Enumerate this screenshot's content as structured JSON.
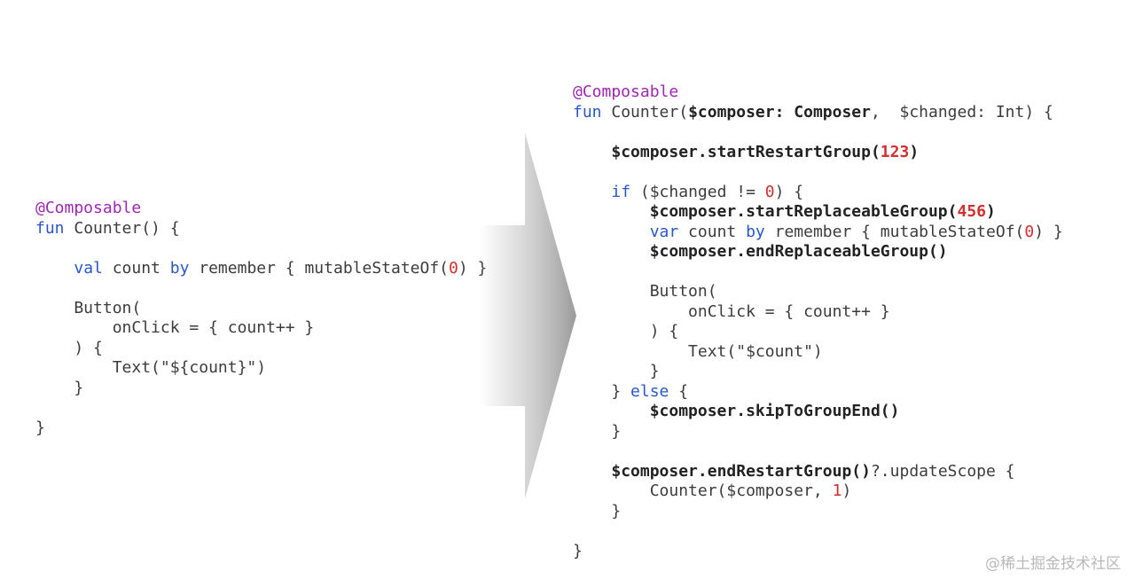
{
  "before_code": {
    "lines": [
      [
        {
          "t": "@Composable",
          "s": "annotation"
        }
      ],
      [
        {
          "t": "fun",
          "s": "keyword"
        },
        {
          "t": " Counter() {",
          "s": "plain"
        }
      ],
      [],
      [
        {
          "t": "    ",
          "s": "plain"
        },
        {
          "t": "val",
          "s": "keyword"
        },
        {
          "t": " count ",
          "s": "plain"
        },
        {
          "t": "by",
          "s": "keyword"
        },
        {
          "t": " remember { mutableStateOf(",
          "s": "plain"
        },
        {
          "t": "0",
          "s": "number"
        },
        {
          "t": ") }",
          "s": "plain"
        }
      ],
      [],
      [
        {
          "t": "    Button(",
          "s": "plain"
        }
      ],
      [
        {
          "t": "        onClick = { count++ }",
          "s": "plain"
        }
      ],
      [
        {
          "t": "    ) {",
          "s": "plain"
        }
      ],
      [
        {
          "t": "        Text(\"${count}\")",
          "s": "plain"
        }
      ],
      [
        {
          "t": "    }",
          "s": "plain"
        }
      ],
      [],
      [
        {
          "t": "}",
          "s": "plain"
        }
      ]
    ]
  },
  "after_code": {
    "lines": [
      [
        {
          "t": "@Composable",
          "s": "annotation"
        }
      ],
      [
        {
          "t": "fun",
          "s": "keyword"
        },
        {
          "t": " Counter(",
          "s": "plain"
        },
        {
          "t": "$composer: Composer",
          "s": "bold"
        },
        {
          "t": ",  $changed: Int) {",
          "s": "plain"
        }
      ],
      [],
      [
        {
          "t": "    ",
          "s": "plain"
        },
        {
          "t": "$composer.startRestartGroup(",
          "s": "bold"
        },
        {
          "t": "123",
          "s": "bold-number"
        },
        {
          "t": ")",
          "s": "bold"
        }
      ],
      [],
      [
        {
          "t": "    ",
          "s": "plain"
        },
        {
          "t": "if",
          "s": "keyword"
        },
        {
          "t": " ($changed != ",
          "s": "plain"
        },
        {
          "t": "0",
          "s": "number"
        },
        {
          "t": ") {",
          "s": "plain"
        }
      ],
      [
        {
          "t": "        ",
          "s": "plain"
        },
        {
          "t": "$composer.startReplaceableGroup(",
          "s": "bold"
        },
        {
          "t": "456",
          "s": "bold-number"
        },
        {
          "t": ")",
          "s": "bold"
        }
      ],
      [
        {
          "t": "        ",
          "s": "plain"
        },
        {
          "t": "var",
          "s": "keyword"
        },
        {
          "t": " count ",
          "s": "plain"
        },
        {
          "t": "by",
          "s": "keyword"
        },
        {
          "t": " remember { mutableStateOf(",
          "s": "plain"
        },
        {
          "t": "0",
          "s": "number"
        },
        {
          "t": ") }",
          "s": "plain"
        }
      ],
      [
        {
          "t": "        ",
          "s": "plain"
        },
        {
          "t": "$composer.endReplaceableGroup()",
          "s": "bold"
        }
      ],
      [],
      [
        {
          "t": "        Button(",
          "s": "plain"
        }
      ],
      [
        {
          "t": "            onClick = { count++ }",
          "s": "plain"
        }
      ],
      [
        {
          "t": "        ) {",
          "s": "plain"
        }
      ],
      [
        {
          "t": "            Text(\"$count\")",
          "s": "plain"
        }
      ],
      [
        {
          "t": "        }",
          "s": "plain"
        }
      ],
      [
        {
          "t": "    } ",
          "s": "plain"
        },
        {
          "t": "else",
          "s": "keyword"
        },
        {
          "t": " {",
          "s": "plain"
        }
      ],
      [
        {
          "t": "        ",
          "s": "plain"
        },
        {
          "t": "$composer.skipToGroupEnd()",
          "s": "bold"
        }
      ],
      [
        {
          "t": "    }",
          "s": "plain"
        }
      ],
      [],
      [
        {
          "t": "    ",
          "s": "plain"
        },
        {
          "t": "$composer.endRestartGroup()",
          "s": "bold"
        },
        {
          "t": "?.updateScope {",
          "s": "plain"
        }
      ],
      [
        {
          "t": "        Counter($composer, ",
          "s": "plain"
        },
        {
          "t": "1",
          "s": "number"
        },
        {
          "t": ")",
          "s": "plain"
        }
      ],
      [
        {
          "t": "    }",
          "s": "plain"
        }
      ],
      [],
      [
        {
          "t": "}",
          "s": "plain"
        }
      ]
    ]
  },
  "colors": {
    "annotation": "#9c27b0",
    "keyword": "#2a57c7",
    "number": "#d32f2f",
    "text": "#3c3c3c",
    "arrow": "#a8a8a8"
  },
  "icons": {
    "transform_arrow": "right-arrow-icon"
  },
  "watermark": "@稀土掘金技术社区"
}
